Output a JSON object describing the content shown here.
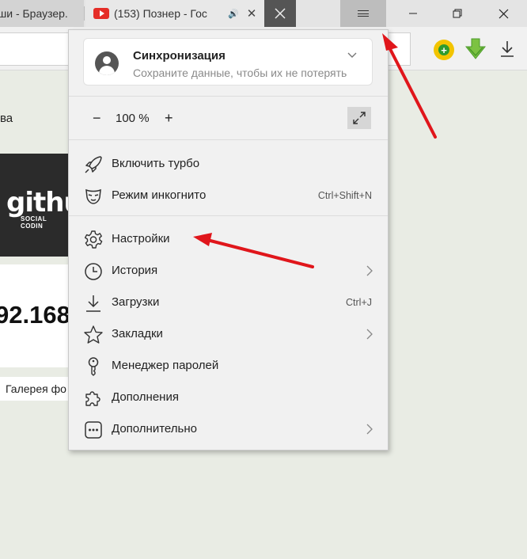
{
  "tabs": [
    {
      "title": "ши - Браузер."
    },
    {
      "title": "(153) Познер - Гос"
    }
  ],
  "menu": {
    "sync": {
      "title": "Синхронизация",
      "subtitle": "Сохраните данные, чтобы их не потерять"
    },
    "zoom": {
      "minus": "−",
      "value": "100 %",
      "plus": "+"
    },
    "items": [
      {
        "label": "Включить турбо",
        "shortcut": ""
      },
      {
        "label": "Режим инкогнито",
        "shortcut": "Ctrl+Shift+N"
      },
      {
        "label": "Настройки",
        "shortcut": ""
      },
      {
        "label": "История",
        "shortcut": ""
      },
      {
        "label": "Загрузки",
        "shortcut": "Ctrl+J"
      },
      {
        "label": "Закладки",
        "shortcut": ""
      },
      {
        "label": "Менеджер паролей",
        "shortcut": ""
      },
      {
        "label": "Дополнения",
        "shortcut": ""
      },
      {
        "label": "Дополнительно",
        "shortcut": ""
      }
    ]
  },
  "page": {
    "fragment_va": "ва",
    "github_word": "githul",
    "github_sub": "SOCIAL CODIN",
    "ip_fragment": "92.168",
    "gallery": "Галерея фо"
  },
  "colors": {
    "annotation_arrow": "#e0161b",
    "menu_bg": "#f1f1f1",
    "youtube_red": "#e52d27"
  },
  "icons": {
    "turbo": "rocket-icon",
    "incognito": "mask-icon",
    "settings": "gear-icon",
    "history": "clock-icon",
    "downloads": "download-icon",
    "bookmarks": "star-icon",
    "passwords": "key-icon",
    "addons": "puzzle-icon",
    "more": "more-dots-icon"
  }
}
